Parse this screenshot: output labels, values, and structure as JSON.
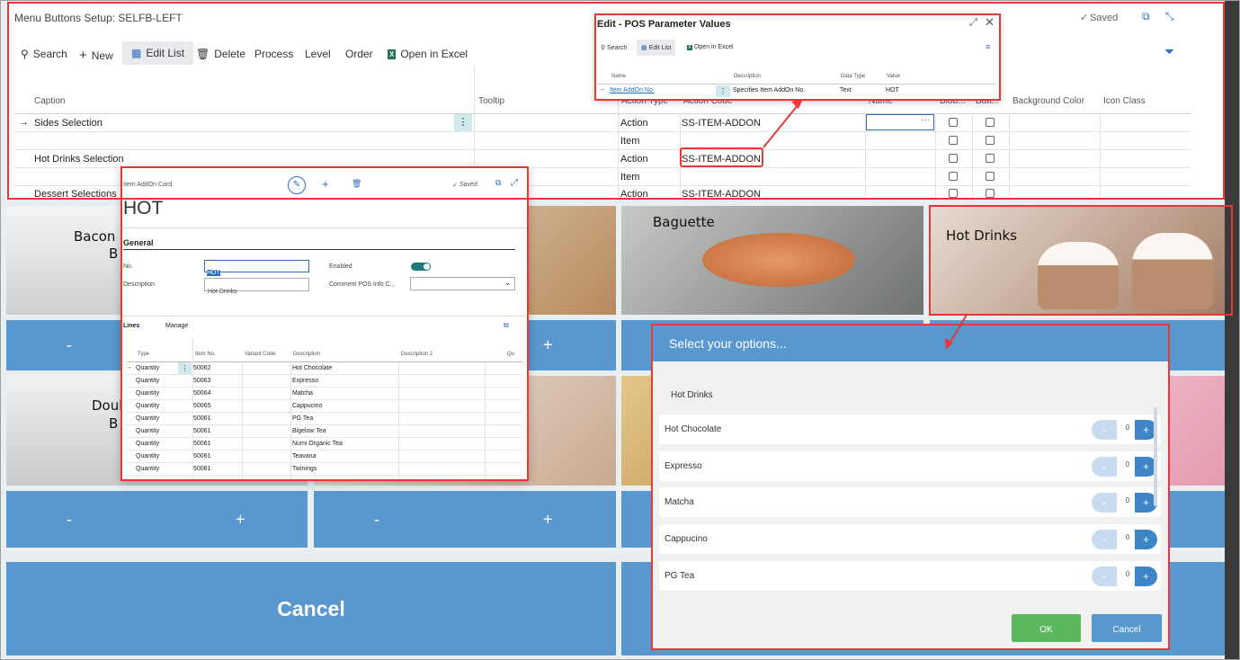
{
  "bc_window": {
    "title": "Menu Buttons Setup: SELFB-LEFT",
    "saved": "Saved",
    "toolbar": {
      "search": "Search",
      "new": "New",
      "edit_list": "Edit List",
      "delete": "Delete",
      "process": "Process",
      "level": "Level",
      "order": "Order",
      "open_in_excel": "Open in Excel"
    },
    "columns": {
      "caption": "Caption",
      "tooltip": "Tooltip",
      "action_type": "Action Type",
      "action_code": "Action Code",
      "name": "Name",
      "blob": "Blob...",
      "butt": "Butt...",
      "background_color": "Background Color",
      "icon_class": "Icon Class"
    },
    "rows": [
      {
        "caption": "Sides Selection",
        "action_type": "Action",
        "action_code": "SS-ITEM-ADDON"
      },
      {
        "caption": "",
        "action_type": "Item",
        "action_code": ""
      },
      {
        "caption": "Hot Drinks Selection",
        "action_type": "Action",
        "action_code": "SS-ITEM-ADDON"
      },
      {
        "caption": "",
        "action_type": "Item",
        "action_code": ""
      },
      {
        "caption": "Dessert Selections",
        "action_type": "Action",
        "action_code": "SS-ITEM-ADDON"
      }
    ]
  },
  "pos_params": {
    "title": "Edit - POS Parameter Values",
    "toolbar": {
      "search": "Search",
      "edit_list": "Edit List",
      "open_in_excel": "Open in Excel"
    },
    "columns": {
      "name": "Name",
      "description": "Description",
      "data_type": "Data Type",
      "value": "Value"
    },
    "row": {
      "name": "Item AddOn No.",
      "description": "Specifies Item AddOn No.",
      "data_type": "Text",
      "value": "HOT"
    }
  },
  "item_card": {
    "breadcrumb": "Item AddOn Card",
    "saved": "Saved",
    "title": "HOT",
    "general": "General",
    "no_label": "No.",
    "no_value": "HOT",
    "enabled_label": "Enabled",
    "description_label": "Description",
    "description_value": "Hot Drinks",
    "comment_label": "Comment POS Info C...",
    "lines_tab": "Lines",
    "manage_tab": "Manage",
    "line_columns": {
      "type": "Type",
      "item_no": "Item No.",
      "variant_code": "Variant Code",
      "description": "Description",
      "description2": "Description 2",
      "qu": "Qu"
    },
    "lines": [
      {
        "type": "Quantity",
        "item_no": "50062",
        "description": "Hot Chocolate"
      },
      {
        "type": "Quantity",
        "item_no": "50063",
        "description": "Expresso"
      },
      {
        "type": "Quantity",
        "item_no": "50064",
        "description": "Matcha"
      },
      {
        "type": "Quantity",
        "item_no": "50065",
        "description": "Cappucino"
      },
      {
        "type": "Quantity",
        "item_no": "50061",
        "description": "PG Tea"
      },
      {
        "type": "Quantity",
        "item_no": "50061",
        "description": "Bigelow Tea"
      },
      {
        "type": "Quantity",
        "item_no": "50061",
        "description": "Numi Organic Tea"
      },
      {
        "type": "Quantity",
        "item_no": "50061",
        "description": "Teavana"
      },
      {
        "type": "Quantity",
        "item_no": "50061",
        "description": "Twinings"
      }
    ]
  },
  "kiosk": {
    "tiles": {
      "bacon": "Bacon",
      "bacon_b": "B",
      "doub": "Doub",
      "doub_b": "B",
      "baguette": "Baguette",
      "hot_drinks": "Hot Drinks"
    },
    "minus": "-",
    "plus": "+",
    "cancel": "Cancel"
  },
  "options": {
    "header": "Select your options...",
    "group": "Hot Drinks",
    "items": [
      {
        "name": "Hot Chocolate",
        "qty": "0"
      },
      {
        "name": "Expresso",
        "qty": "0"
      },
      {
        "name": "Matcha",
        "qty": "0"
      },
      {
        "name": "Cappucino",
        "qty": "0"
      },
      {
        "name": "PG Tea",
        "qty": "0"
      }
    ],
    "ok": "OK",
    "cancel": "Cancel"
  },
  "colors": {
    "accent": "#5898cf",
    "annotation": "#e53935",
    "ok_green": "#5cb85c"
  }
}
